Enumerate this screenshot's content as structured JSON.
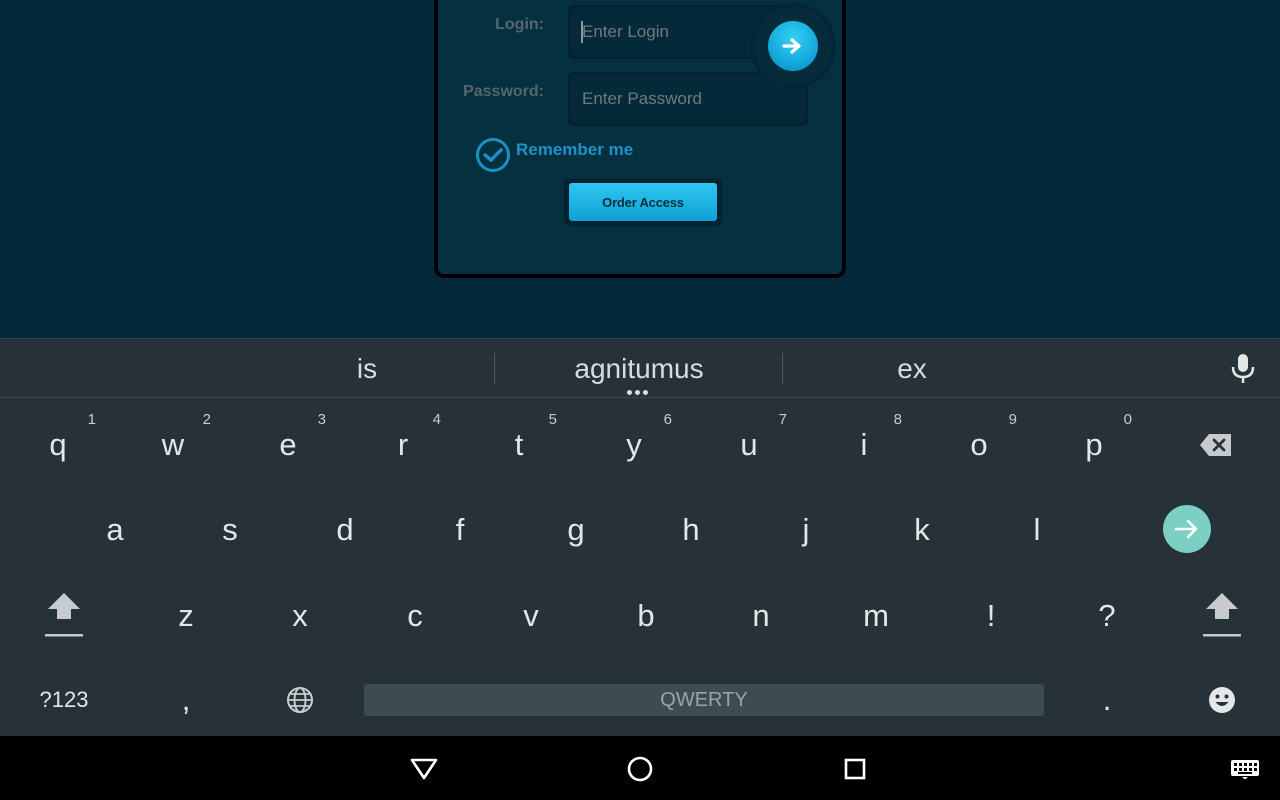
{
  "login_form": {
    "login_label": "Login:",
    "login_placeholder": "Enter Login",
    "password_label": "Password:",
    "password_placeholder": "Enter Password",
    "remember_label": "Remember me",
    "remember_checked": true,
    "order_button_label": "Order Access",
    "accent_color": "#1ea8dc"
  },
  "keyboard": {
    "suggestions": [
      "is",
      "agnitumus",
      "ex"
    ],
    "row1": [
      {
        "key": "q",
        "hint": "1"
      },
      {
        "key": "w",
        "hint": "2"
      },
      {
        "key": "e",
        "hint": "3"
      },
      {
        "key": "r",
        "hint": "4"
      },
      {
        "key": "t",
        "hint": "5"
      },
      {
        "key": "y",
        "hint": "6"
      },
      {
        "key": "u",
        "hint": "7"
      },
      {
        "key": "i",
        "hint": "8"
      },
      {
        "key": "o",
        "hint": "9"
      },
      {
        "key": "p",
        "hint": "0"
      }
    ],
    "row2": [
      "a",
      "s",
      "d",
      "f",
      "g",
      "h",
      "j",
      "k",
      "l"
    ],
    "row3": [
      "z",
      "x",
      "c",
      "v",
      "b",
      "n",
      "m",
      "!",
      "?"
    ],
    "symbols_label": "?123",
    "comma": ",",
    "period": ".",
    "space_label": "QWERTY",
    "enter_color": "#7ccfc3"
  },
  "icons": {
    "go": "arrow-right-icon",
    "check": "checkmark-icon",
    "mic": "microphone-icon",
    "backspace": "backspace-icon",
    "enter": "arrow-right-icon",
    "shift": "shift-icon",
    "globe": "globe-icon",
    "emoji": "emoji-icon",
    "back": "back-triangle-icon",
    "home": "home-circle-icon",
    "recents": "recents-square-icon",
    "keyboard": "keyboard-icon"
  }
}
